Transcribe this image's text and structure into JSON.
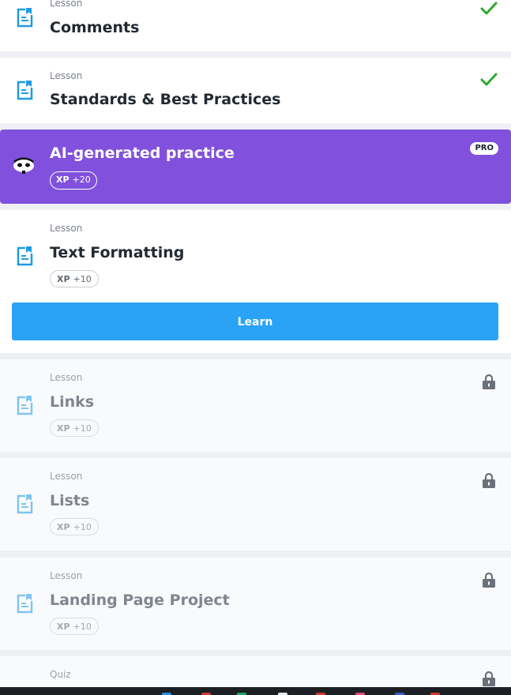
{
  "lessons": [
    {
      "type": "Lesson",
      "title": "Comments",
      "status": "completed"
    },
    {
      "type": "Lesson",
      "title": "Standards & Best Practices",
      "status": "completed"
    },
    {
      "type": "Lesson",
      "title": "Text Formatting",
      "xp_label": "XP",
      "xp_value": "+10",
      "status": "current"
    },
    {
      "type": "Lesson",
      "title": "Links",
      "xp_label": "XP",
      "xp_value": "+10",
      "status": "locked"
    },
    {
      "type": "Lesson",
      "title": "Lists",
      "xp_label": "XP",
      "xp_value": "+10",
      "status": "locked"
    },
    {
      "type": "Lesson",
      "title": "Landing Page Project",
      "xp_label": "XP",
      "xp_value": "+10",
      "status": "locked"
    },
    {
      "type": "Quiz",
      "status": "locked"
    }
  ],
  "ai_practice": {
    "title": "AI-generated practice",
    "xp_label": "XP",
    "xp_value": "+20",
    "badge": "PRO",
    "icon": "bot-face-icon"
  },
  "learn_button": {
    "label": "Learn"
  },
  "icons": {
    "lesson": "lesson-doc-icon",
    "completed": "check-icon",
    "locked": "lock-icon"
  },
  "colors": {
    "accent_blue": "#2aa3f6",
    "ai_purple": "#8151dd",
    "check_green": "#2ea82e",
    "lesson_icon": "#1e9be4"
  }
}
